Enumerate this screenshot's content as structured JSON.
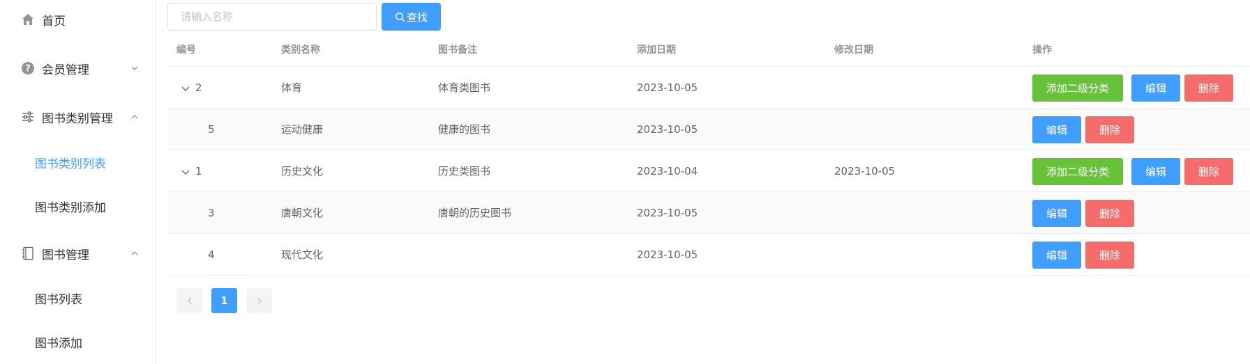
{
  "sidebar": {
    "home": "首页",
    "members": "会员管理",
    "category_mgmt": "图书类别管理",
    "category_list": "图书类别列表",
    "category_add": "图书类别添加",
    "book_mgmt": "图书管理",
    "book_list": "图书列表",
    "book_add": "图书添加"
  },
  "search": {
    "placeholder": "请输入名称",
    "button": "查找"
  },
  "table": {
    "headers": [
      "编号",
      "类别名称",
      "图书备注",
      "添加日期",
      "修改日期",
      "操作"
    ],
    "rows": [
      {
        "id": "2",
        "name": "体育",
        "note": "体育类图书",
        "added": "2023-10-05",
        "modified": ""
      },
      {
        "id": "5",
        "name": "运动健康",
        "note": "健康的图书",
        "added": "2023-10-05",
        "modified": ""
      },
      {
        "id": "1",
        "name": "历史文化",
        "note": "历史类图书",
        "added": "2023-10-04",
        "modified": "2023-10-05"
      },
      {
        "id": "3",
        "name": "唐朝文化",
        "note": "唐朝的历史图书",
        "added": "2023-10-05",
        "modified": ""
      },
      {
        "id": "4",
        "name": "现代文化",
        "note": "",
        "added": "2023-10-05",
        "modified": ""
      }
    ],
    "actions": {
      "add_sub": "添加二级分类",
      "edit": "编辑",
      "delete": "删除"
    }
  },
  "pagination": {
    "current": "1"
  },
  "colors": {
    "primary": "#409eff",
    "success": "#67c23a",
    "danger": "#f56c6c"
  }
}
